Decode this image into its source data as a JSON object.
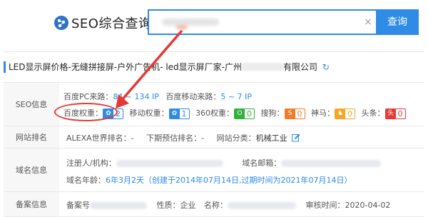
{
  "header": {
    "logo_text": "SEO综合查询",
    "search_value": "",
    "search_button": "查询",
    "clear_symbol": "×"
  },
  "company": {
    "title_prefix": "LED显示屏价格-无缝拼接屏-户外广告机- led显示屏厂家-广州",
    "title_suffix": "有限公司",
    "refresh_symbol": "↻"
  },
  "seo_info": {
    "label": "SEO信息",
    "pc_label": "百度PC来路：",
    "pc_value": "84 ~ 134 IP",
    "mobile_label": "百度移动来路：",
    "mobile_value": "5 ~ 7 IP",
    "weights": [
      {
        "label": "百度权重：",
        "icon": "paw-icon",
        "glyph": "✿",
        "value": "2",
        "color": "#2f8be6"
      },
      {
        "label": "移动权重：",
        "icon": "paw-icon",
        "glyph": "✿",
        "value": "1",
        "color": "#2f8be6"
      },
      {
        "label": "360权重：",
        "icon": "360-icon",
        "glyph": "O",
        "value": "0",
        "color": "#31b03a"
      },
      {
        "label": "搜狗：",
        "icon": "sogou-icon",
        "glyph": "S",
        "value": "0",
        "color": "#f07b2a"
      },
      {
        "label": "神马：",
        "icon": "shenma-icon",
        "glyph": "♞",
        "value": "0",
        "color": "#f5a623"
      },
      {
        "label": "头条：",
        "icon": "toutiao-icon",
        "glyph": "头",
        "value": "0",
        "color": "#e53935"
      }
    ]
  },
  "site_rank": {
    "label": "网站排名",
    "alexa_label": "ALEXA世界排名：",
    "alexa_value": "-",
    "predict_label": "下期预估排名：",
    "predict_value": "-",
    "category_label": "网站分类：",
    "category_value": "机械工业"
  },
  "domain_info": {
    "label": "域名信息",
    "registrant_label": "注册人/机构：",
    "email_label": "域名邮箱：",
    "age_label": "域名年龄：",
    "age_value": "6年3月2天",
    "age_detail": "（创建于2014年07月14日,过期时间为2021年07月14日）"
  },
  "icp_info": {
    "label": "备案信息",
    "number_label": "备案号",
    "nature_label": "性质：",
    "nature_value": "企业",
    "name_label": "名称：",
    "audit_label": "审核时间：",
    "audit_value": "2020-04-02"
  }
}
